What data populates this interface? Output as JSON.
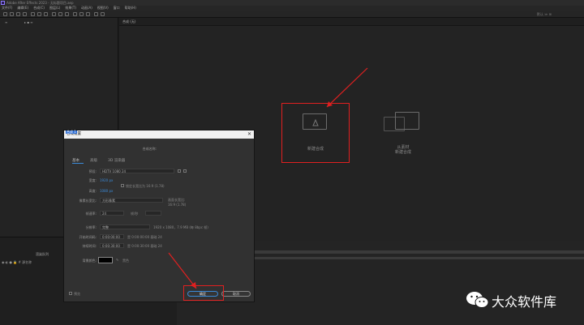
{
  "app": {
    "title": "Adobe After Effects 2023 - 无标题项目.aep",
    "menu": [
      "文件(F)",
      "编辑(E)",
      "合成(C)",
      "图层(L)",
      "效果(T)",
      "动画(A)",
      "视图(V)",
      "窗口",
      "帮助(H)"
    ],
    "toolbar_right": "默认  ≫  ⊞"
  },
  "viewer": {
    "tab_label": "合成 (无)",
    "new_comp_label": "新建合成",
    "from_footage_line1": "从素材",
    "from_footage_line2": "新建合成"
  },
  "dialog": {
    "title": "合成设置",
    "close_glyph": "✕",
    "name_label": "合成名称:",
    "name_value": "合成 1",
    "tabs": [
      "基本",
      "高级",
      "3D 渲染器"
    ],
    "preset_label": "预设:",
    "preset_value": "HDTV 1080 24",
    "width_label": "宽度:",
    "width_value": "1920 px",
    "height_label": "高度:",
    "height_value": "1080 px",
    "lock_aspect_label": "锁定长宽比为 16:9 (1.78)",
    "pixel_aspect_label": "像素长宽比:",
    "pixel_aspect_value": "方形像素",
    "frame_aspect_label": "画面长宽比:",
    "frame_aspect_value": "16:9 (1.78)",
    "frame_rate_label": "帧速率:",
    "frame_rate_value": "24",
    "frame_rate_unit": "帧/秒",
    "resolution_label": "分辨率:",
    "resolution_value": "完整",
    "resolution_info": "1920 x 1080，7.9 MB (每 8bpc 帧)",
    "start_timecode_label": "开始时间码:",
    "start_timecode_value": "0:00:00:00",
    "start_timecode_info": "是 0:00:00:00 基础 24",
    "duration_label": "持续时间:",
    "duration_value": "0:00:30:00",
    "duration_info": "是 0:00:30:00 基础 24",
    "bg_color_label": "背景颜色:",
    "bg_color_name": "黑色",
    "preview_label": "预览",
    "ok_button": "确定",
    "cancel_button": "取消"
  },
  "lower_panel": {
    "tab": "渲染队列",
    "row_text": "◉ ◐ ● 🔒  #  源名称"
  },
  "watermark": {
    "text": "大众软件库"
  },
  "colors": {
    "accent_blue": "#3b8ad8",
    "highlight_red": "#e02020",
    "panel_bg": "#232323"
  }
}
